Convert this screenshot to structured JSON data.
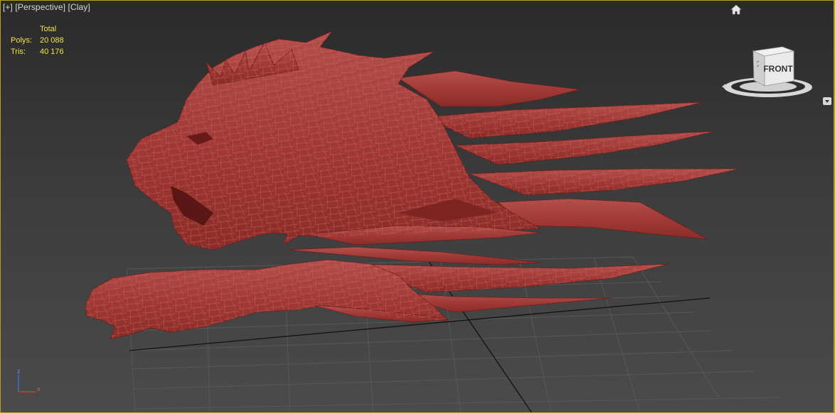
{
  "viewport": {
    "label_plus": "[+]",
    "label_view": "[Perspective]",
    "label_shading": "[Clay]"
  },
  "stats": {
    "header": "Total",
    "polys_label": "Polys:",
    "polys_value": "20 088",
    "tris_label": "Tris:",
    "tris_value": "40 176"
  },
  "viewcube": {
    "face_label": "FRONT"
  },
  "axis": {
    "z": "z",
    "x": "x"
  },
  "colors": {
    "frame": "#b79e2c",
    "stats_text": "#f2e64a",
    "model_fill": "#a23a37",
    "model_edges": "#c8625e",
    "grid": "#5a5a5a"
  },
  "icons": [
    "home-icon",
    "viewcube-icon",
    "viewcube-menu-icon",
    "axis-tripod-icon"
  ]
}
